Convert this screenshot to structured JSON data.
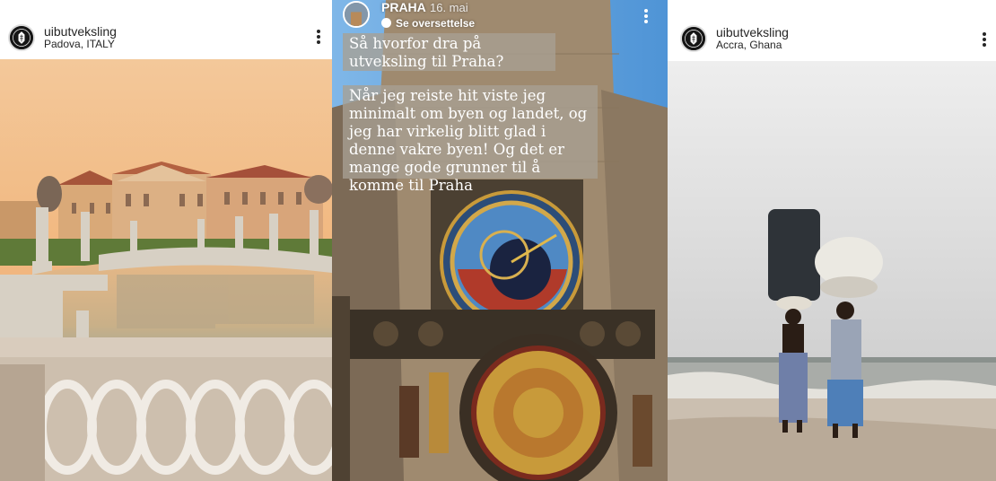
{
  "posts": [
    {
      "username": "uibutveksling",
      "location": "Padova, ITALY"
    },
    {
      "story_user": "PRAHA",
      "story_date": "16. mai",
      "translate_label": "Se oversettelse",
      "caption_1": "Så hvorfor dra på utveksling til Praha?",
      "caption_2": "Når jeg reiste hit viste jeg minimalt om byen og landet, og jeg har virkelig blitt glad i denne vakre byen! Og det er mange gode grunner til å komme til Praha"
    },
    {
      "username": "uibutveksling",
      "location": "Accra, Ghana"
    }
  ],
  "icons": {
    "more": "more-options-icon",
    "translate": "speech-bubble-icon",
    "avatar": "university-seal"
  },
  "colors": {
    "text": "#262626",
    "story_caption_bg": "#a8a094",
    "white": "#ffffff"
  }
}
